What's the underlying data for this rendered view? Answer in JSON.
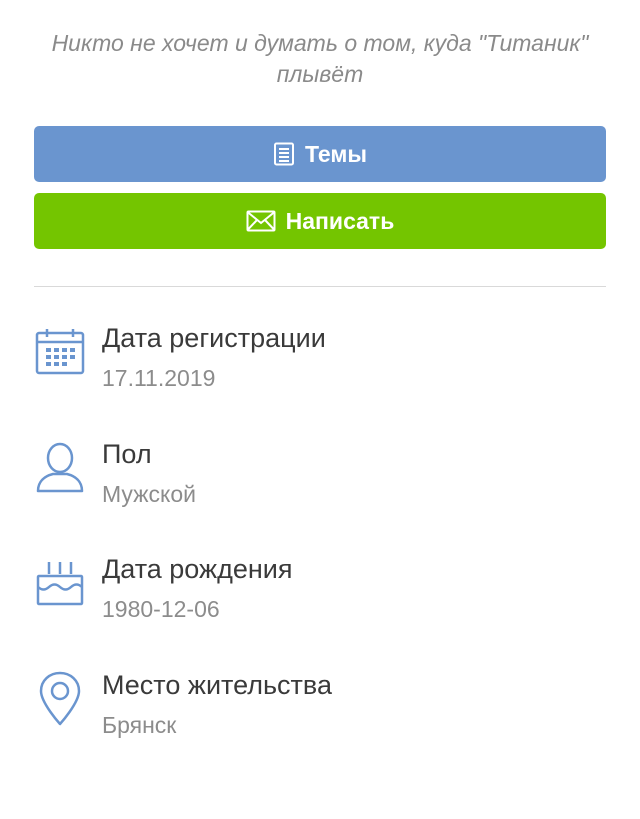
{
  "profile": {
    "status_quote": "Никто не хочет и думать о том, куда \"Титаник\" плывёт"
  },
  "actions": {
    "topics_label": "Темы",
    "write_label": "Написать"
  },
  "info": [
    {
      "label": "Дата регистрации",
      "value": "17.11.2019",
      "icon": "calendar-icon"
    },
    {
      "label": "Пол",
      "value": "Мужской",
      "icon": "person-icon"
    },
    {
      "label": "Дата рождения",
      "value": "1980-12-06",
      "icon": "birthday-cake-icon"
    },
    {
      "label": "Место жительства",
      "value": "Брянск",
      "icon": "location-pin-icon"
    }
  ],
  "colors": {
    "topics_button": "#6a95cf",
    "write_button": "#74c500",
    "icon_blue": "#6a95cf"
  }
}
